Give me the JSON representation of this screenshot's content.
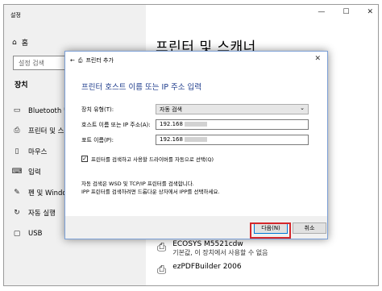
{
  "window": {
    "title": "설정",
    "controls": [
      "—",
      "☐",
      "✕"
    ]
  },
  "sidebar": {
    "home": "홈",
    "search_placeholder": "설정 검색",
    "section": "장치",
    "items": [
      {
        "label": "Bluetooth 및",
        "icon": "bluetooth-icon"
      },
      {
        "label": "프린터 및 스",
        "icon": "printer-icon"
      },
      {
        "label": "마우스",
        "icon": "mouse-icon"
      },
      {
        "label": "입력",
        "icon": "keyboard-icon"
      },
      {
        "label": "펜 및 Window",
        "icon": "pen-icon"
      },
      {
        "label": "자동 실행",
        "icon": "autoplay-icon"
      },
      {
        "label": "USB",
        "icon": "usb-icon"
      }
    ]
  },
  "main": {
    "title": "프린터 및 스캐너",
    "printers": [
      {
        "name": "ECOSYS M5521cdw",
        "status": "기본값, 이 장치에서 사용할 수 없음"
      },
      {
        "name": "ezPDFBuilder 2006",
        "status": ""
      }
    ]
  },
  "dialog": {
    "title": "프린터 추가",
    "close": "✕",
    "heading": "프린터 호스트 이름 또는 IP 주소 입력",
    "device_type_label": "장치 유형(T):",
    "device_type_value": "자동 검색",
    "host_label": "호스트 이름 또는 IP 주소(A):",
    "host_value": "192.168",
    "port_label": "포트 이름(P):",
    "port_value": "192.168",
    "checkbox_label": "프린터를 검색하고 사용할 드라이버를 자동으로 선택(Q)",
    "checkbox_checked": true,
    "info_line1": "자동 검색은 WSD 및 TCP/IP 프린터를 검색합니다.",
    "info_line2": "IPP 프린터를 검색하려면 드롭다운 상자에서 IPP를 선택하세요.",
    "next_label": "다음(N)",
    "cancel_label": "취소"
  }
}
